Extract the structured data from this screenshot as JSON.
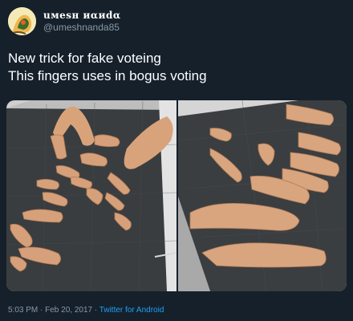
{
  "user": {
    "display_name": "uмesн иαиdα",
    "handle": "@umeshnanda85"
  },
  "tweet": {
    "text_line_1": "New trick for fake voteing",
    "text_line_2": "This fingers uses in bogus voting"
  },
  "media": {
    "photo_count": 2
  },
  "footer": {
    "timestamp": "5:03 PM · Feb 20, 2017",
    "separator": " · ",
    "source": "Twitter for Android"
  },
  "colors": {
    "background": "#15202b",
    "text": "#ffffff",
    "secondary_text": "#8899a6",
    "link": "#1da1f2"
  }
}
